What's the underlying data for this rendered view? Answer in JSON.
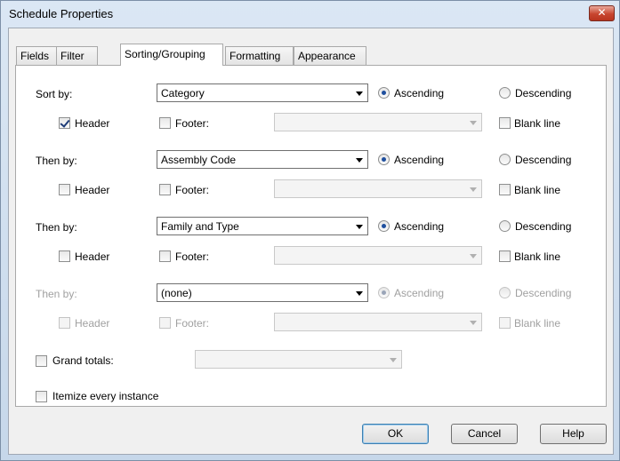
{
  "window": {
    "title": "Schedule Properties",
    "close_glyph": "✕"
  },
  "tabs": [
    {
      "label": "Fields",
      "active": false
    },
    {
      "label": "Filter",
      "active": false
    },
    {
      "label": "Sorting/Grouping",
      "active": true
    },
    {
      "label": "Formatting",
      "active": false
    },
    {
      "label": "Appearance",
      "active": false
    }
  ],
  "sort_groups": [
    {
      "label": "Sort by:",
      "field": "Category",
      "order": "Ascending",
      "ascending_label": "Ascending",
      "descending_label": "Descending",
      "header_label": "Header",
      "header_checked": true,
      "footer_label": "Footer:",
      "footer_checked": false,
      "footer_value": "",
      "blank_line_label": "Blank line",
      "blank_line_checked": false,
      "enabled": true
    },
    {
      "label": "Then by:",
      "field": "Assembly Code",
      "order": "Ascending",
      "ascending_label": "Ascending",
      "descending_label": "Descending",
      "header_label": "Header",
      "header_checked": false,
      "footer_label": "Footer:",
      "footer_checked": false,
      "footer_value": "",
      "blank_line_label": "Blank line",
      "blank_line_checked": false,
      "enabled": true
    },
    {
      "label": "Then by:",
      "field": "Family and Type",
      "order": "Ascending",
      "ascending_label": "Ascending",
      "descending_label": "Descending",
      "header_label": "Header",
      "header_checked": false,
      "footer_label": "Footer:",
      "footer_checked": false,
      "footer_value": "",
      "blank_line_label": "Blank line",
      "blank_line_checked": false,
      "enabled": true
    },
    {
      "label": "Then by:",
      "field": "(none)",
      "order": "Ascending",
      "ascending_label": "Ascending",
      "descending_label": "Descending",
      "header_label": "Header",
      "header_checked": false,
      "footer_label": "Footer:",
      "footer_checked": false,
      "footer_value": "",
      "blank_line_label": "Blank line",
      "blank_line_checked": false,
      "enabled": false
    }
  ],
  "grand_totals": {
    "label": "Grand totals:",
    "checked": false,
    "value": ""
  },
  "itemize": {
    "label": "Itemize every instance",
    "checked": false
  },
  "buttons": {
    "ok": "OK",
    "cancel": "Cancel",
    "help": "Help"
  }
}
